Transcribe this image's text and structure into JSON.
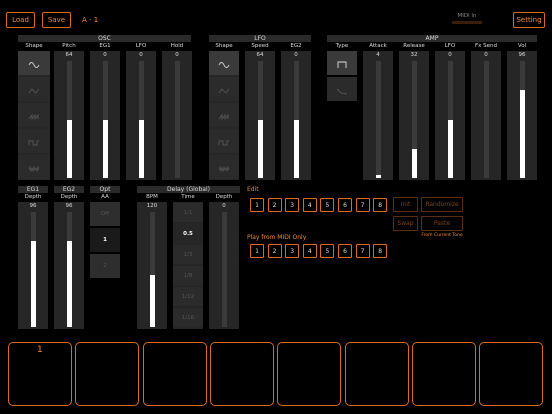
{
  "header": {
    "load_label": "Load",
    "save_label": "Save",
    "preset_name": "A - 1",
    "midi_in_label": "MIDI In",
    "setting_label": "Setting"
  },
  "osc": {
    "title": "OSC",
    "shape_label": "Shape",
    "shapes": [
      "sine-wave-icon",
      "triangle-wave-icon",
      "saw-wave-icon",
      "square-wave-icon",
      "noise-wave-icon"
    ],
    "selected_shape": 0,
    "sliders": [
      {
        "label": "Pitch",
        "value": "64",
        "level": 0.5
      },
      {
        "label": "EG1",
        "value": "0",
        "level": 0.5
      },
      {
        "label": "LFO",
        "value": "0",
        "level": 0.5
      },
      {
        "label": "Hold",
        "value": "0",
        "level": 0.0
      }
    ]
  },
  "lfo": {
    "title": "LFO",
    "shape_label": "Shape",
    "shapes": [
      "sine-wave-icon",
      "triangle-wave-icon",
      "saw-wave-icon",
      "square-wave-icon",
      "noise-wave-icon"
    ],
    "selected_shape": 0,
    "sliders": [
      {
        "label": "Speed",
        "value": "64",
        "level": 0.5
      },
      {
        "label": "EG2",
        "value": "0",
        "level": 0.5
      }
    ]
  },
  "amp": {
    "title": "AMP",
    "type_label": "Type",
    "types": [
      "gate-icon",
      "envelope-icon"
    ],
    "selected_type": 0,
    "sliders": [
      {
        "label": "Attack",
        "value": "4",
        "level": 0.03
      },
      {
        "label": "Release",
        "value": "32",
        "level": 0.25
      },
      {
        "label": "LFO",
        "value": "0",
        "level": 0.5
      },
      {
        "label": "Fx Send",
        "value": "0",
        "level": 0.0
      },
      {
        "label": "Vol",
        "value": "96",
        "level": 0.75
      }
    ]
  },
  "eg1": {
    "title": "EG1",
    "label": "Depth",
    "value": "96",
    "level": 0.75
  },
  "eg2": {
    "title": "EG2",
    "label": "Depth",
    "value": "96",
    "level": 0.75
  },
  "opt": {
    "title": "Opt",
    "label": "AA",
    "options": [
      "Off",
      "1",
      "2"
    ],
    "selected": 1
  },
  "delay": {
    "title": "Delay (Global)",
    "bpm_label": "BPM",
    "bpm_value": "120",
    "bpm_level": 0.45,
    "time_label": "Time",
    "time_options": [
      "1/1",
      "0.5",
      "1/3",
      "1/8",
      "1/12",
      "1/16"
    ],
    "time_selected": 1,
    "depth_label": "Depth",
    "depth_value": "0",
    "depth_level": 0.0
  },
  "edit": {
    "title": "Edit",
    "buttons": [
      "1",
      "2",
      "3",
      "4",
      "5",
      "6",
      "7",
      "8"
    ],
    "init_label": "Init",
    "randomize_label": "Randomize",
    "swap_label": "Swap",
    "paste_label": "Paste",
    "from_current_label": "From Current Tone"
  },
  "play": {
    "title": "Play from MIDI Only",
    "buttons": [
      "1",
      "2",
      "3",
      "4",
      "5",
      "6",
      "7",
      "8"
    ]
  },
  "pads": {
    "labels": [
      "1",
      "",
      "",
      "",
      "",
      "",
      "",
      ""
    ]
  },
  "colors": {
    "accent": "#f08a3a",
    "border": "#d96a1e",
    "panel": "#262626"
  }
}
